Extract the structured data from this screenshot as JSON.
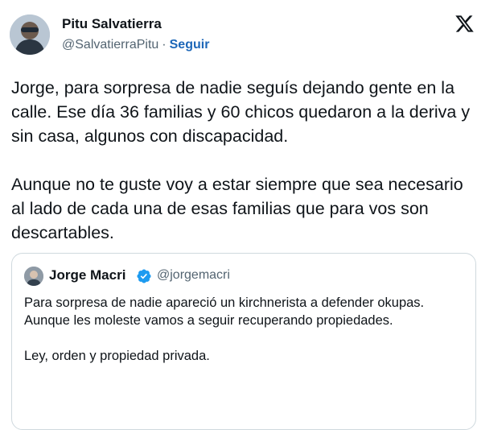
{
  "author": {
    "name": "Pitu Salvatierra",
    "handle": "@SalvatierraPitu",
    "separator": "·",
    "follow_label": "Seguir"
  },
  "logo_icon": "x-logo-icon",
  "tweet": {
    "paragraph1": "Jorge, para sorpresa de nadie seguís dejando gente en la calle. Ese día 36 familias y 60 chicos quedaron a la deriva y sin casa, algunos con discapacidad.",
    "paragraph2": "Aunque no te guste voy a estar siempre que sea necesario al lado de cada una de esas familias que para vos son descartables."
  },
  "quoted": {
    "name": "Jorge Macri",
    "verified_icon": "verified-badge-icon",
    "handle": "@jorgemacri",
    "line1": "Para sorpresa de nadie apareció un kirchnerista a defender okupas.",
    "line2": "Aunque les moleste vamos a seguir recuperando propiedades.",
    "line3": "Ley, orden y propiedad privada."
  },
  "colors": {
    "link": "#1d67b8",
    "verified": "#1d9bf0",
    "secondary_text": "#536471",
    "border": "#cfd9de"
  }
}
